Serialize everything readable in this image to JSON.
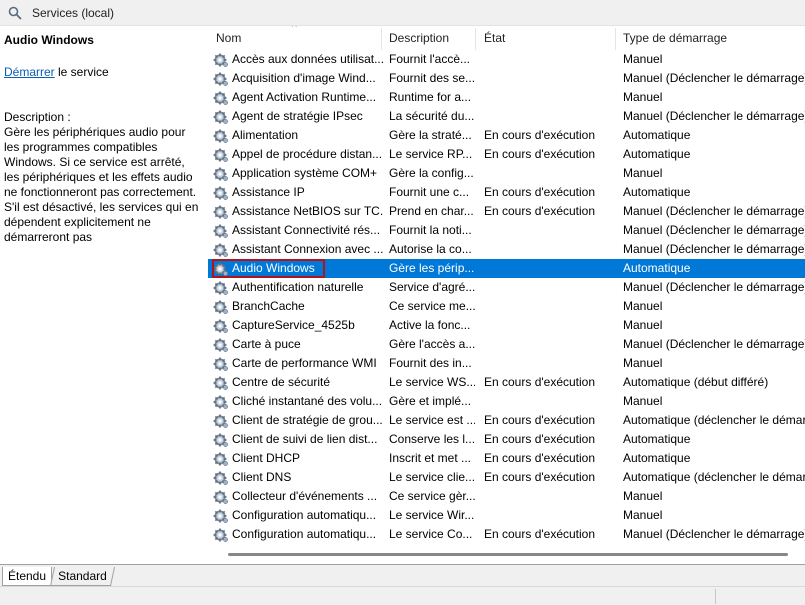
{
  "window": {
    "title": "Services (local)"
  },
  "left_pane": {
    "title": "Audio Windows",
    "action_link": "Démarrer",
    "action_rest": " le service",
    "description_label": "Description :",
    "description": "Gère les périphériques audio pour les programmes compatibles Windows. Si ce service est arrêté, les périphériques et les effets audio ne fonctionneront pas correctement. S'il est désactivé, les services qui en dépendent explicitement ne démarreront pas"
  },
  "columns": {
    "name": "Nom",
    "description": "Description",
    "state": "État",
    "startup": "Type de démarrage"
  },
  "services": [
    {
      "name": "Accès aux données utilisat...",
      "description": "Fournit l'accè...",
      "state": "",
      "startup": "Manuel"
    },
    {
      "name": "Acquisition d'image Wind...",
      "description": "Fournit des se...",
      "state": "",
      "startup": "Manuel (Déclencher le démarrage)"
    },
    {
      "name": "Agent Activation Runtime...",
      "description": "Runtime for a...",
      "state": "",
      "startup": "Manuel"
    },
    {
      "name": "Agent de stratégie IPsec",
      "description": "La sécurité du...",
      "state": "",
      "startup": "Manuel (Déclencher le démarrage)"
    },
    {
      "name": "Alimentation",
      "description": "Gère la straté...",
      "state": "En cours d'exécution",
      "startup": "Automatique"
    },
    {
      "name": "Appel de procédure distan...",
      "description": "Le service RP...",
      "state": "En cours d'exécution",
      "startup": "Automatique"
    },
    {
      "name": "Application système COM+",
      "description": "Gère la config...",
      "state": "",
      "startup": "Manuel"
    },
    {
      "name": "Assistance IP",
      "description": "Fournit une c...",
      "state": "En cours d'exécution",
      "startup": "Automatique"
    },
    {
      "name": "Assistance NetBIOS sur TC...",
      "description": "Prend en char...",
      "state": "En cours d'exécution",
      "startup": "Manuel (Déclencher le démarrage)"
    },
    {
      "name": "Assistant Connectivité rés...",
      "description": "Fournit la noti...",
      "state": "",
      "startup": "Manuel (Déclencher le démarrage)"
    },
    {
      "name": "Assistant Connexion avec ...",
      "description": "Autorise la co...",
      "state": "",
      "startup": "Manuel (Déclencher le démarrage)"
    },
    {
      "name": "Audio Windows",
      "description": "Gère les périp...",
      "state": "",
      "startup": "Automatique",
      "selected": true
    },
    {
      "name": "Authentification naturelle",
      "description": "Service d'agré...",
      "state": "",
      "startup": "Manuel (Déclencher le démarrage)"
    },
    {
      "name": "BranchCache",
      "description": "Ce service me...",
      "state": "",
      "startup": "Manuel"
    },
    {
      "name": "CaptureService_4525b",
      "description": "Active la fonc...",
      "state": "",
      "startup": "Manuel"
    },
    {
      "name": "Carte à puce",
      "description": "Gère l'accès a...",
      "state": "",
      "startup": "Manuel (Déclencher le démarrage)"
    },
    {
      "name": "Carte de performance WMI",
      "description": "Fournit des in...",
      "state": "",
      "startup": "Manuel"
    },
    {
      "name": "Centre de sécurité",
      "description": "Le service WS...",
      "state": "En cours d'exécution",
      "startup": "Automatique (début différé)"
    },
    {
      "name": "Cliché instantané des volu...",
      "description": "Gère et implé...",
      "state": "",
      "startup": "Manuel"
    },
    {
      "name": "Client de stratégie de grou...",
      "description": "Le service est ...",
      "state": "En cours d'exécution",
      "startup": "Automatique (déclencher le démarrage)"
    },
    {
      "name": "Client de suivi de lien dist...",
      "description": "Conserve les l...",
      "state": "En cours d'exécution",
      "startup": "Automatique"
    },
    {
      "name": "Client DHCP",
      "description": "Inscrit et met ...",
      "state": "En cours d'exécution",
      "startup": "Automatique"
    },
    {
      "name": "Client DNS",
      "description": "Le service clie...",
      "state": "En cours d'exécution",
      "startup": "Automatique (déclencher le démarrage)"
    },
    {
      "name": "Collecteur d'événements ...",
      "description": "Ce service gèr...",
      "state": "",
      "startup": "Manuel"
    },
    {
      "name": "Configuration automatiqu...",
      "description": "Le service Wir...",
      "state": "",
      "startup": "Manuel"
    },
    {
      "name": "Configuration automatiqu...",
      "description": "Le service Co...",
      "state": "En cours d'exécution",
      "startup": "Manuel (Déclencher le démarrage)"
    }
  ],
  "tabs": [
    {
      "label": "Étendu",
      "active": true
    },
    {
      "label": "Standard",
      "active": false
    }
  ],
  "icons": {
    "service": "gear-icon",
    "title": "services-icon"
  },
  "colors": {
    "selection": "#0078d7",
    "link": "#0a5fb4",
    "focus": "#b0141c"
  }
}
